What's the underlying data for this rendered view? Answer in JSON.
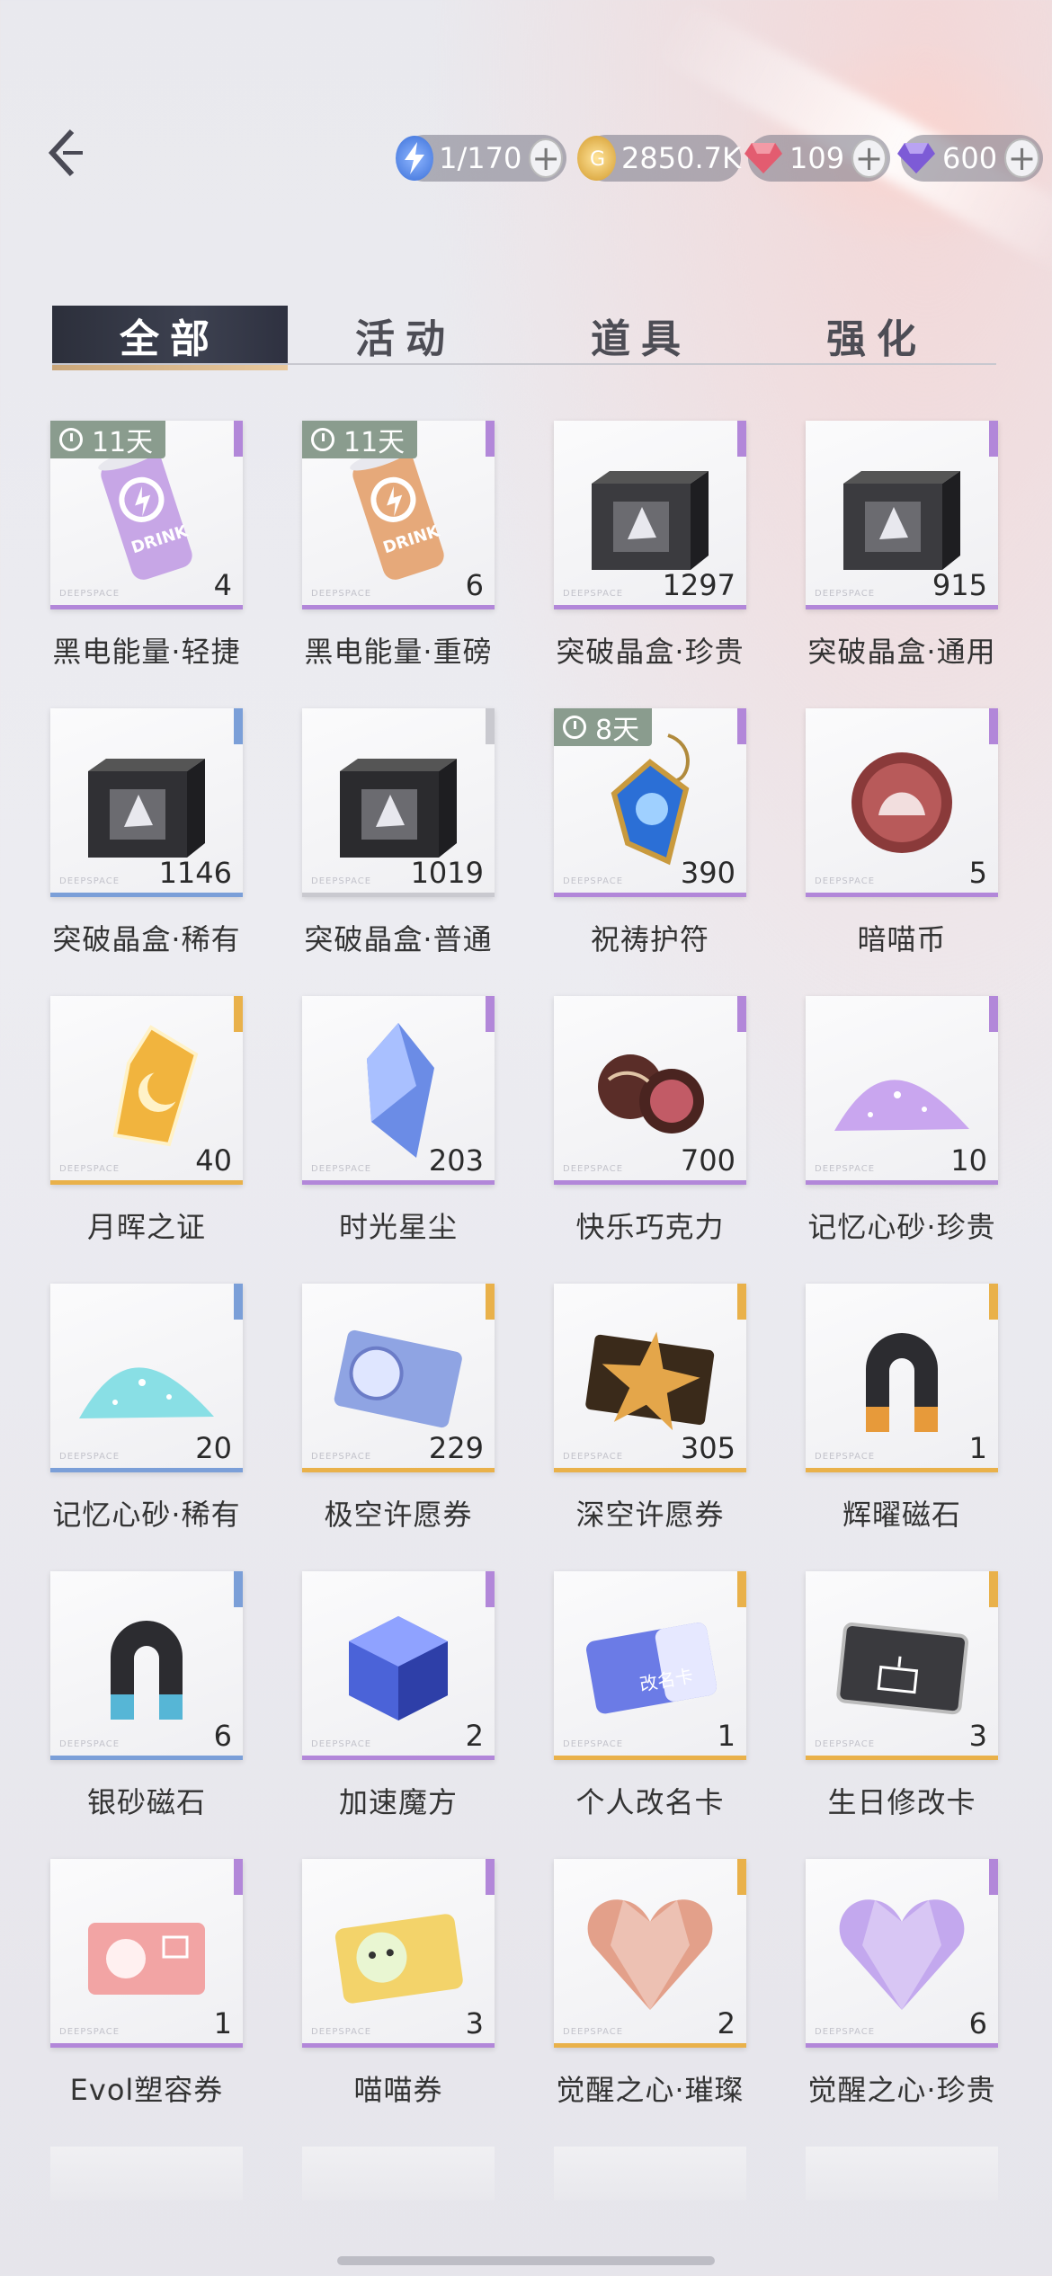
{
  "colors": {
    "accent_gold": "#e0b464",
    "rarity_purple": "#b287d9",
    "rarity_blue": "#7b9fd8",
    "rarity_gold": "#e9b14a",
    "timer_bg": "#8a9c8e"
  },
  "resources": [
    {
      "icon": "energy-bolt-icon",
      "value": "1/170"
    },
    {
      "icon": "gold-coin-icon",
      "value": "2850.7K"
    },
    {
      "icon": "red-diamond-icon",
      "value": "109"
    },
    {
      "icon": "purple-diamond-icon",
      "value": "600"
    }
  ],
  "tabs": [
    "全部",
    "活动",
    "道具",
    "强化"
  ],
  "items": [
    {
      "name": "黑电能量·轻捷",
      "count": "4",
      "timer": "11天",
      "rarity": "purple",
      "icon": "drink-can-icon",
      "hue": "#c7a6e6"
    },
    {
      "name": "黑电能量·重磅",
      "count": "6",
      "timer": "11天",
      "rarity": "purple",
      "icon": "drink-can-icon",
      "hue": "#e6a97a"
    },
    {
      "name": "突破晶盒·珍贵",
      "count": "1297",
      "timer": "",
      "rarity": "purple",
      "icon": "crystal-box-icon",
      "hue": "#3b3b3f"
    },
    {
      "name": "突破晶盒·通用",
      "count": "915",
      "timer": "",
      "rarity": "purple",
      "icon": "crystal-box-icon",
      "hue": "#3b3b3f"
    },
    {
      "name": "突破晶盒·稀有",
      "count": "1146",
      "timer": "",
      "rarity": "blue",
      "icon": "crystal-box-icon",
      "hue": "#303034"
    },
    {
      "name": "突破晶盒·普通",
      "count": "1019",
      "timer": "",
      "rarity": "gray",
      "icon": "crystal-box-icon",
      "hue": "#2b2b2e"
    },
    {
      "name": "祝祷护符",
      "count": "390",
      "timer": "8天",
      "rarity": "purple",
      "icon": "amulet-icon",
      "hue": "#2b6fd6"
    },
    {
      "name": "暗喵币",
      "count": "5",
      "timer": "",
      "rarity": "purple",
      "icon": "cat-coin-icon",
      "hue": "#8a3a3a"
    },
    {
      "name": "月晖之证",
      "count": "40",
      "timer": "",
      "rarity": "gold",
      "icon": "moon-badge-icon",
      "hue": "#f1b43e"
    },
    {
      "name": "时光星尘",
      "count": "203",
      "timer": "",
      "rarity": "purple",
      "icon": "crystal-shard-icon",
      "hue": "#6b8ce6"
    },
    {
      "name": "快乐巧克力",
      "count": "700",
      "timer": "",
      "rarity": "purple",
      "icon": "chocolate-icon",
      "hue": "#5a2d28"
    },
    {
      "name": "记忆心砂·珍贵",
      "count": "10",
      "timer": "",
      "rarity": "purple",
      "icon": "sand-pile-icon",
      "hue": "#c9a6ef"
    },
    {
      "name": "记忆心砂·稀有",
      "count": "20",
      "timer": "",
      "rarity": "blue",
      "icon": "sand-pile-icon",
      "hue": "#89dfe5"
    },
    {
      "name": "极空许愿券",
      "count": "229",
      "timer": "",
      "rarity": "gold",
      "icon": "wish-ticket-icon",
      "hue": "#8fa4e3"
    },
    {
      "name": "深空许愿券",
      "count": "305",
      "timer": "",
      "rarity": "gold",
      "icon": "star-ticket-icon",
      "hue": "#e4a64a"
    },
    {
      "name": "辉曜磁石",
      "count": "1",
      "timer": "",
      "rarity": "gold",
      "icon": "magnet-icon",
      "hue": "#e79a3a"
    },
    {
      "name": "银砂磁石",
      "count": "6",
      "timer": "",
      "rarity": "blue",
      "icon": "magnet-icon",
      "hue": "#56b6d6"
    },
    {
      "name": "加速魔方",
      "count": "2",
      "timer": "",
      "rarity": "purple",
      "icon": "cube-icon",
      "hue": "#4b63d8"
    },
    {
      "name": "个人改名卡",
      "count": "1",
      "timer": "",
      "rarity": "gold",
      "icon": "rename-card-icon",
      "hue": "#6b7be6"
    },
    {
      "name": "生日修改卡",
      "count": "3",
      "timer": "",
      "rarity": "gold",
      "icon": "birthday-card-icon",
      "hue": "#3a3a3e"
    },
    {
      "name": "Evol塑容券",
      "count": "1",
      "timer": "",
      "rarity": "purple",
      "icon": "evol-ticket-icon",
      "hue": "#f2a4a4"
    },
    {
      "name": "喵喵券",
      "count": "3",
      "timer": "",
      "rarity": "purple",
      "icon": "meow-ticket-icon",
      "hue": "#f3d36a"
    },
    {
      "name": "觉醒之心·璀璨",
      "count": "2",
      "timer": "",
      "rarity": "gold",
      "icon": "heart-gem-icon",
      "hue": "#e3a08a"
    },
    {
      "name": "觉醒之心·珍贵",
      "count": "6",
      "timer": "",
      "rarity": "purple",
      "icon": "heart-gem-icon",
      "hue": "#c3a8ee"
    }
  ]
}
